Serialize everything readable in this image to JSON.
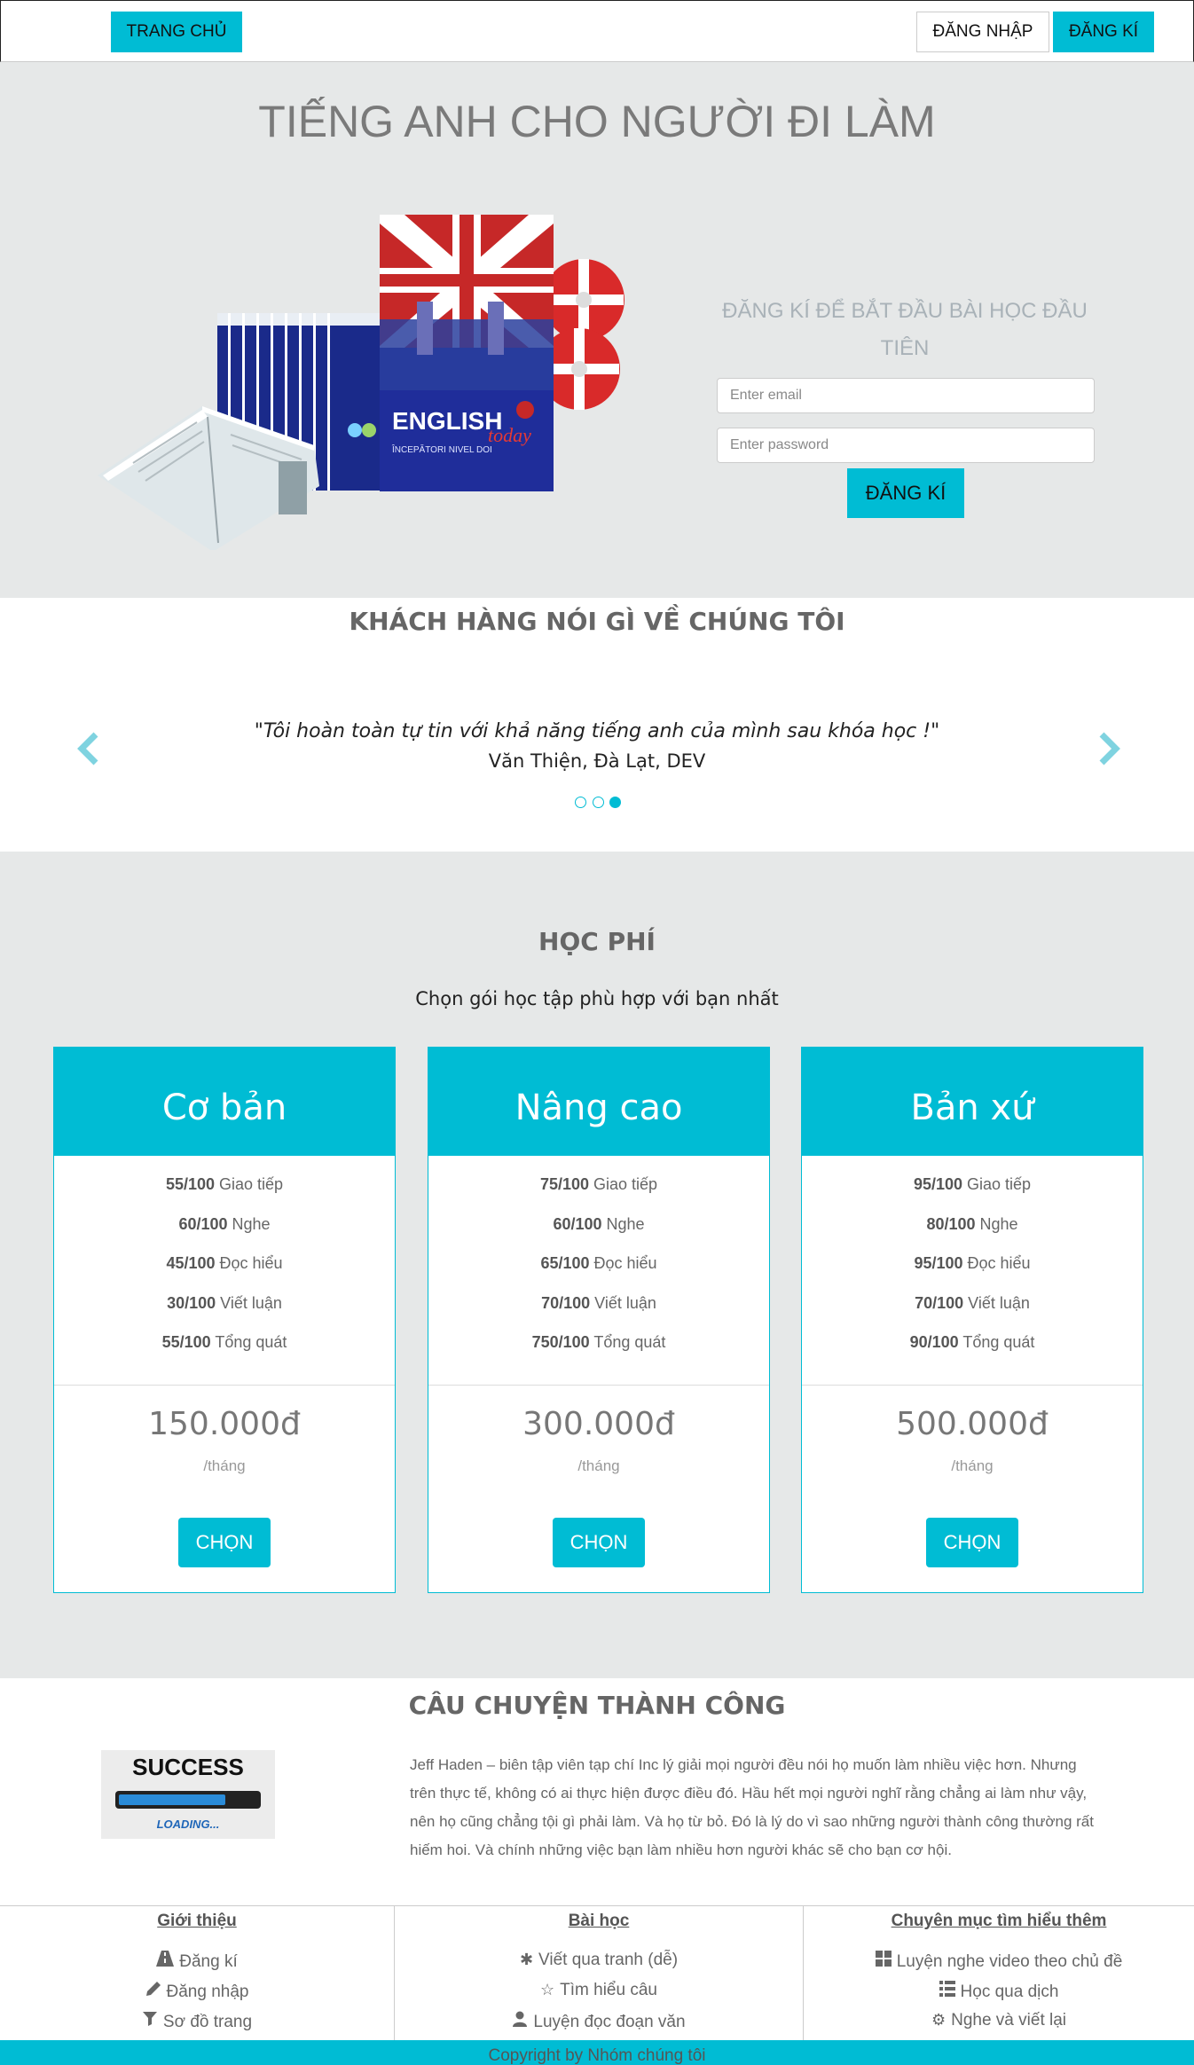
{
  "nav": {
    "home": "TRANG CHỦ",
    "login": "ĐĂNG NHẬP",
    "signup": "ĐĂNG KÍ"
  },
  "hero": {
    "title": "TIẾNG ANH CHO NGƯỜI ĐI LÀM",
    "form_title": "ĐĂNG KÍ ĐỂ BẮT ĐẦU BÀI HỌC ĐẦU TIÊN",
    "email_placeholder": "Enter email",
    "password_placeholder": "Enter password",
    "submit": "ĐĂNG KÍ",
    "product_text": "ENGLISH",
    "product_script": "today",
    "product_sub": "ÎNCEPĂTORI NIVEL DOI"
  },
  "testimonials": {
    "heading": "KHÁCH HÀNG NÓI GÌ VỀ CHÚNG TÔI",
    "quote": "\"Tôi hoàn toàn tự tin với khả năng tiếng anh của mình sau khóa học !\"",
    "author": "Văn Thiện, Đà Lạt, DEV"
  },
  "pricing": {
    "heading": "HỌC PHÍ",
    "subtitle": "Chọn gói học tập phù hợp với bạn nhất",
    "plans": [
      {
        "name": "Cơ bản",
        "features": [
          {
            "score": "55/100",
            "label": " Giao tiếp"
          },
          {
            "score": "60/100",
            "label": " Nghe"
          },
          {
            "score": "45/100",
            "label": " Đọc hiểu"
          },
          {
            "score": "30/100",
            "label": " Viết luận"
          },
          {
            "score": "55/100",
            "label": " Tổng quát"
          }
        ],
        "price": "150.000đ",
        "period": "/tháng",
        "button": "CHỌN"
      },
      {
        "name": "Nâng cao",
        "features": [
          {
            "score": "75/100",
            "label": " Giao tiếp"
          },
          {
            "score": "60/100",
            "label": " Nghe"
          },
          {
            "score": "65/100",
            "label": " Đọc hiểu"
          },
          {
            "score": "70/100",
            "label": " Viết luận"
          },
          {
            "score": "750/100",
            "label": " Tổng quát"
          }
        ],
        "price": "300.000đ",
        "period": "/tháng",
        "button": "CHỌN"
      },
      {
        "name": "Bản xứ",
        "features": [
          {
            "score": "95/100",
            "label": " Giao tiếp"
          },
          {
            "score": "80/100",
            "label": " Nghe"
          },
          {
            "score": "95/100",
            "label": " Đọc hiểu"
          },
          {
            "score": "70/100",
            "label": " Viết luận"
          },
          {
            "score": "90/100",
            "label": " Tổng quát"
          }
        ],
        "price": "500.000đ",
        "period": "/tháng",
        "button": "CHỌN"
      }
    ]
  },
  "success": {
    "heading": "CÂU CHUYỆN THÀNH CÔNG",
    "image_title": "SUCCESS",
    "image_caption": "LOADING...",
    "story": "Jeff Haden – biên tập viên tạp chí Inc lý giải mọi người đều nói họ muốn làm nhiều việc hơn. Nhưng trên thực tế, không có ai thực hiện được điều đó. Hầu hết mọi người nghĩ rằng chẳng ai làm như vậy, nên họ cũng chẳng tội gì phải làm. Và họ từ bỏ. Đó là lý do vì sao những người thành công thường rất hiếm hoi. Và chính những việc bạn làm nhiều hơn người khác sẽ cho bạn cơ hội."
  },
  "footer": {
    "columns": [
      {
        "title": "Giới thiệu",
        "links": [
          {
            "icon": "road-icon",
            "label": "Đăng kí"
          },
          {
            "icon": "pencil-icon",
            "label": "Đăng nhập"
          },
          {
            "icon": "filter-icon",
            "label": "Sơ đồ trang"
          }
        ]
      },
      {
        "title": "Bài học",
        "links": [
          {
            "icon": "asterisk-icon",
            "label": "Viết qua tranh (dễ)"
          },
          {
            "icon": "star-icon",
            "label": "Tìm hiểu câu"
          },
          {
            "icon": "user-icon",
            "label": "Luyện đọc đoạn văn"
          }
        ]
      },
      {
        "title": "Chuyên mục tìm hiểu thêm",
        "links": [
          {
            "icon": "th-large-icon",
            "label": "Luyện nghe video theo chủ đề"
          },
          {
            "icon": "th-list-icon",
            "label": "Học qua dịch"
          },
          {
            "icon": "cog-icon",
            "label": "Nghe và viết lại"
          }
        ]
      }
    ],
    "copyright": "Copyright by Nhóm chúng tôi"
  },
  "colors": {
    "accent": "#00bcd4",
    "section_gray": "#e6e8e8"
  }
}
